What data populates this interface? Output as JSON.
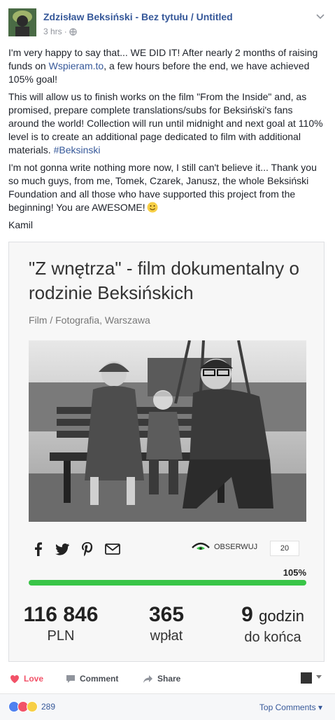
{
  "post": {
    "author": "Zdzisław Beksiński - Bez tytułu / Untitled",
    "time": "3 hrs",
    "separator": "·",
    "paragraph1_before": "I'm very happy to say that... WE DID IT! After nearly 2 months of raising funds on ",
    "paragraph1_link": "Wspieram.to",
    "paragraph1_after": ", a few hours before the end, we have achieved 105% goal!",
    "paragraph2_text": "This will allow us to finish works on the film \"From the Inside\" and, as promised, prepare complete translations/subs for Beksiński's fans around the world! Collection will run until midnight and next goal at 110% level is to create an additional page dedicated to film with additional materials. ",
    "paragraph2_hashtag": "#Beksinski",
    "paragraph3": "I'm not gonna write nothing more now, I still can't believe it... Thank you so much guys, from me, Tomek, Czarek, Janusz, the whole Beksiński Foundation and all those who have supported this project from the beginning! You are AWESOME!",
    "signature": "Kamil"
  },
  "card": {
    "title": "\"Z wnętrza\" - film dokumentalny o rodzinie Beksińskich",
    "subtitle": "Film / Fotografia, Warszawa",
    "observe_label": "OBSERWUJ",
    "observe_count": "20",
    "percent_label": "105%",
    "progress_fraction": 1.0,
    "stats": [
      {
        "num": "116 846",
        "label": "PLN"
      },
      {
        "num": "365",
        "label": "wpłat"
      },
      {
        "num": "9",
        "num_suffix": "godzin",
        "label": "do końca"
      }
    ],
    "accent_color": "#39c547"
  },
  "actions": {
    "love": "Love",
    "comment": "Comment",
    "share": "Share"
  },
  "reactions": {
    "count": "289",
    "top_comments": "Top Comments"
  }
}
